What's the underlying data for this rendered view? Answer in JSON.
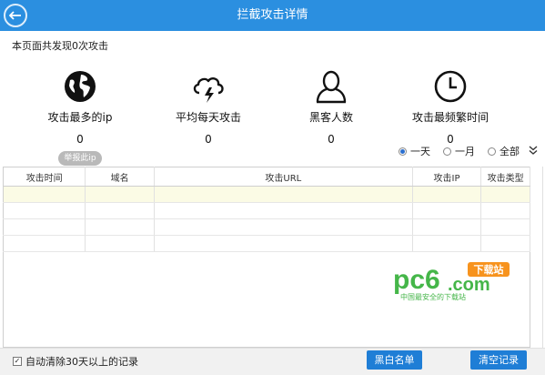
{
  "window": {
    "title": "拦截攻击详情",
    "back_icon": "back-arrow-icon"
  },
  "summary": "本页面共发现0次攻击",
  "stats": [
    {
      "icon": "globe-icon",
      "label": "攻击最多的ip",
      "value": "0",
      "action": "举报此ip"
    },
    {
      "icon": "cloud-lightning-icon",
      "label": "平均每天攻击",
      "value": "0"
    },
    {
      "icon": "hacker-person-icon",
      "label": "黑客人数",
      "value": "0"
    },
    {
      "icon": "clock-icon",
      "label": "攻击最频繁时间",
      "value": "0"
    }
  ],
  "range": {
    "options": [
      "一天",
      "一月",
      "全部"
    ],
    "selected": "一天",
    "expand_icon": "double-chevron-down-icon"
  },
  "table": {
    "columns": [
      "攻击时间",
      "域名",
      "攻击URL",
      "攻击IP",
      "攻击类型"
    ],
    "rows": []
  },
  "watermark": {
    "logo": "pc6.com",
    "badge": "下载站",
    "tagline": "中国最安全的下载站"
  },
  "footer": {
    "auto_clear_label": "自动清除30天以上的记录",
    "auto_clear_checked": true,
    "blacklist_button": "黑白名单",
    "clear_button": "清空记录"
  },
  "colors": {
    "accent": "#2b8fe0",
    "button": "#1f7ed6",
    "highlight_row": "#fbfbe5"
  }
}
